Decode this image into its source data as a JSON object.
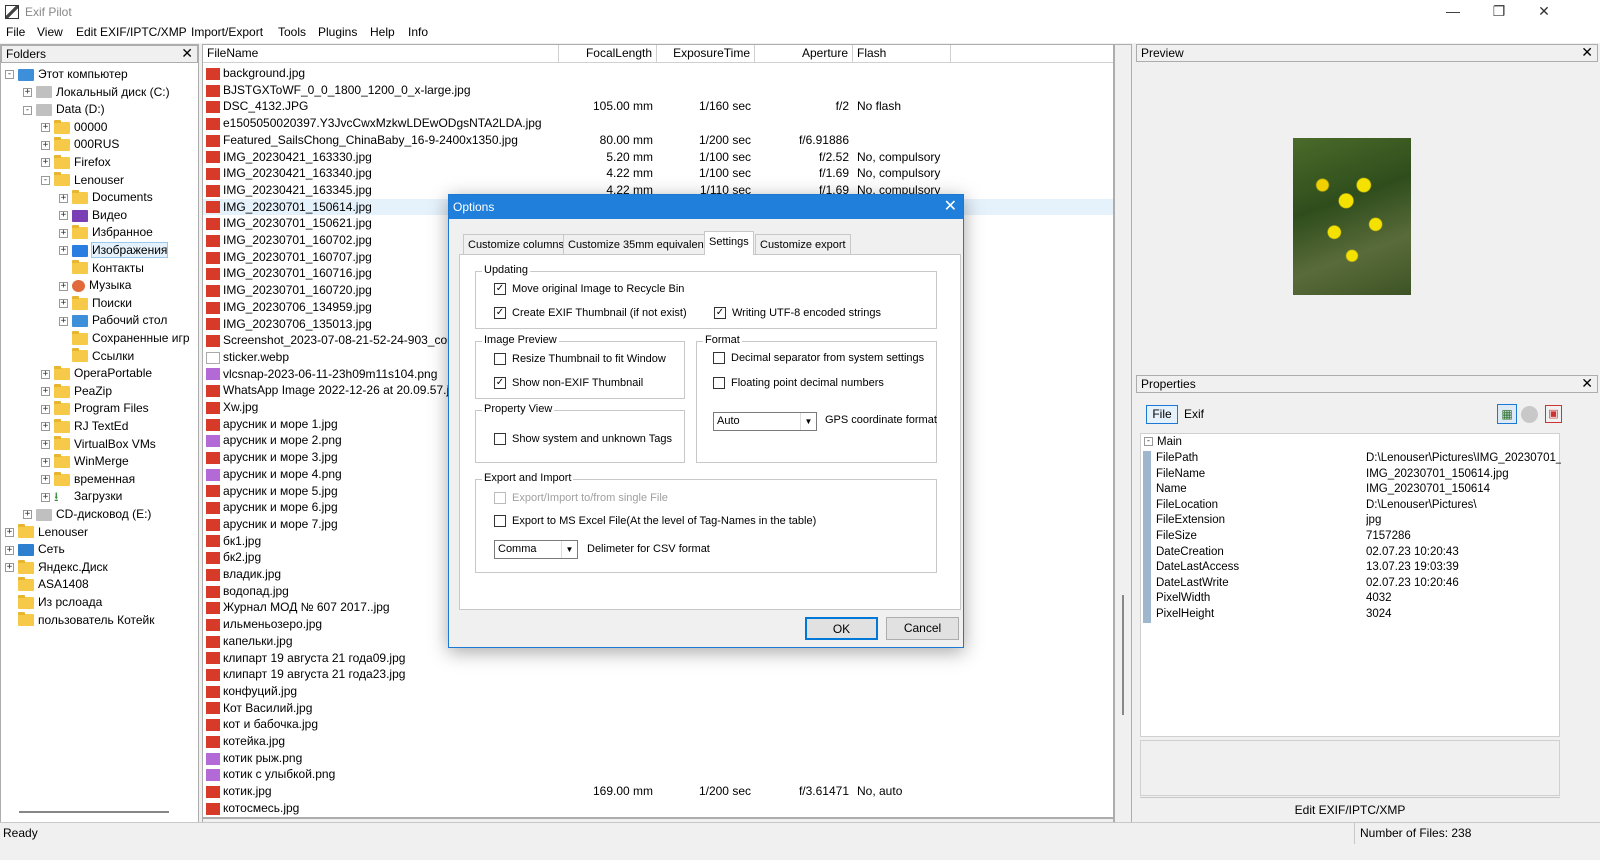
{
  "app": {
    "title": "Exif Pilot",
    "min": "—",
    "max": "❐",
    "close": "✕"
  },
  "menu": [
    "File",
    "View",
    "Edit EXIF/IPTC/XMP",
    "Import/Export",
    "Tools",
    "Plugins",
    "Help",
    "Info"
  ],
  "folders": {
    "title": "Folders",
    "close": "✕",
    "items": [
      {
        "label": "Этот компьютер",
        "indent": 0,
        "exp": "-",
        "icon": "pc"
      },
      {
        "label": "Локальный диск (C:)",
        "indent": 1,
        "exp": "+",
        "icon": "drv"
      },
      {
        "label": "Data (D:)",
        "indent": 1,
        "exp": "-",
        "icon": "drv"
      },
      {
        "label": "00000",
        "indent": 2,
        "exp": "+",
        "icon": "folder"
      },
      {
        "label": "000RUS",
        "indent": 2,
        "exp": "+",
        "icon": "folder"
      },
      {
        "label": "Firefox",
        "indent": 2,
        "exp": "+",
        "icon": "folder"
      },
      {
        "label": "Lenouser",
        "indent": 2,
        "exp": "-",
        "icon": "folder"
      },
      {
        "label": "Documents",
        "indent": 3,
        "exp": "+",
        "icon": "folder"
      },
      {
        "label": "Видео",
        "indent": 3,
        "exp": "+",
        "icon": "vid"
      },
      {
        "label": "Избранное",
        "indent": 3,
        "exp": "+",
        "icon": "folder"
      },
      {
        "label": "Изображения",
        "indent": 3,
        "exp": "+",
        "icon": "img",
        "selected": true
      },
      {
        "label": "Контакты",
        "indent": 3,
        "exp": "",
        "icon": "folder"
      },
      {
        "label": "Музыка",
        "indent": 3,
        "exp": "+",
        "icon": "mus"
      },
      {
        "label": "Поиски",
        "indent": 3,
        "exp": "+",
        "icon": "folder"
      },
      {
        "label": "Рабочий стол",
        "indent": 3,
        "exp": "+",
        "icon": "pc"
      },
      {
        "label": "Сохраненные игр",
        "indent": 3,
        "exp": "",
        "icon": "folder"
      },
      {
        "label": "Ссылки",
        "indent": 3,
        "exp": "",
        "icon": "folder"
      },
      {
        "label": "OperaPortable",
        "indent": 2,
        "exp": "+",
        "icon": "folder"
      },
      {
        "label": "PeaZip",
        "indent": 2,
        "exp": "+",
        "icon": "folder"
      },
      {
        "label": "Program Files",
        "indent": 2,
        "exp": "+",
        "icon": "folder"
      },
      {
        "label": "RJ TextEd",
        "indent": 2,
        "exp": "+",
        "icon": "folder"
      },
      {
        "label": "VirtualBox VMs",
        "indent": 2,
        "exp": "+",
        "icon": "folder"
      },
      {
        "label": "WinMerge",
        "indent": 2,
        "exp": "+",
        "icon": "folder"
      },
      {
        "label": "временная",
        "indent": 2,
        "exp": "+",
        "icon": "folder"
      },
      {
        "label": "Загрузки",
        "indent": 2,
        "exp": "+",
        "icon": "dl"
      },
      {
        "label": "CD-дисковод (E:)",
        "indent": 1,
        "exp": "+",
        "icon": "drv"
      },
      {
        "label": "Lenouser",
        "indent": 0,
        "exp": "+",
        "icon": "folder"
      },
      {
        "label": "Сеть",
        "indent": 0,
        "exp": "+",
        "icon": "net"
      },
      {
        "label": "Яндекс.Диск",
        "indent": 0,
        "exp": "+",
        "icon": "folder"
      },
      {
        "label": "ASA1408",
        "indent": 0,
        "exp": "",
        "icon": "folder"
      },
      {
        "label": "Из рслоада",
        "indent": 0,
        "exp": "",
        "icon": "folder"
      },
      {
        "label": "пользователь Котейк",
        "indent": 0,
        "exp": "",
        "icon": "folder"
      }
    ]
  },
  "filelist": {
    "columns": [
      "FileName",
      "FocalLength",
      "ExposureTime",
      "Aperture",
      "Flash"
    ],
    "rows": [
      {
        "name": "background.jpg",
        "type": "jpg",
        "focal": "",
        "exp": "",
        "ap": "",
        "flash": ""
      },
      {
        "name": "BJSTGXToWF_0_0_1800_1200_0_x-large.jpg",
        "type": "jpg",
        "focal": "",
        "exp": "",
        "ap": "",
        "flash": ""
      },
      {
        "name": "DSC_4132.JPG",
        "type": "jpg",
        "focal": "105.00 mm",
        "exp": "1/160 sec",
        "ap": "f/2",
        "flash": "No flash"
      },
      {
        "name": "e1505050020397.Y3JvcCwxMzkwLDEwODgsNTA2LDA.jpg",
        "type": "jpg",
        "focal": "",
        "exp": "",
        "ap": "",
        "flash": ""
      },
      {
        "name": "Featured_SailsChong_ChinaBaby_16-9-2400x1350.jpg",
        "type": "jpg",
        "focal": "80.00 mm",
        "exp": "1/200 sec",
        "ap": "f/6.91886",
        "flash": ""
      },
      {
        "name": "IMG_20230421_163330.jpg",
        "type": "jpg",
        "focal": "5.20 mm",
        "exp": "1/100 sec",
        "ap": "f/2.52",
        "flash": "No, compulsory"
      },
      {
        "name": "IMG_20230421_163340.jpg",
        "type": "jpg",
        "focal": "4.22 mm",
        "exp": "1/100 sec",
        "ap": "f/1.69",
        "flash": "No, compulsory"
      },
      {
        "name": "IMG_20230421_163345.jpg",
        "type": "jpg",
        "focal": "4.22 mm",
        "exp": "1/110 sec",
        "ap": "f/1.69",
        "flash": "No, compulsory"
      },
      {
        "name": "IMG_20230701_150614.jpg",
        "type": "jpg",
        "focal": "",
        "exp": "",
        "ap": "",
        "flash": "",
        "selected": true
      },
      {
        "name": "IMG_20230701_150621.jpg",
        "type": "jpg",
        "focal": "",
        "exp": "",
        "ap": "",
        "flash": ""
      },
      {
        "name": "IMG_20230701_160702.jpg",
        "type": "jpg",
        "focal": "",
        "exp": "",
        "ap": "",
        "flash": ""
      },
      {
        "name": "IMG_20230701_160707.jpg",
        "type": "jpg",
        "focal": "",
        "exp": "",
        "ap": "",
        "flash": ""
      },
      {
        "name": "IMG_20230701_160716.jpg",
        "type": "jpg",
        "focal": "",
        "exp": "",
        "ap": "",
        "flash": ""
      },
      {
        "name": "IMG_20230701_160720.jpg",
        "type": "jpg",
        "focal": "",
        "exp": "",
        "ap": "",
        "flash": ""
      },
      {
        "name": "IMG_20230706_134959.jpg",
        "type": "jpg",
        "focal": "",
        "exp": "",
        "ap": "",
        "flash": ""
      },
      {
        "name": "IMG_20230706_135013.jpg",
        "type": "jpg",
        "focal": "",
        "exp": "",
        "ap": "",
        "flash": ""
      },
      {
        "name": "Screenshot_2023-07-08-21-52-24-903_com.m",
        "type": "jpg",
        "focal": "",
        "exp": "",
        "ap": "",
        "flash": ""
      },
      {
        "name": "sticker.webp",
        "type": "webp",
        "focal": "",
        "exp": "",
        "ap": "",
        "flash": ""
      },
      {
        "name": "vlcsnap-2023-06-11-23h09m11s104.png",
        "type": "png",
        "focal": "",
        "exp": "",
        "ap": "",
        "flash": ""
      },
      {
        "name": "WhatsApp Image 2022-12-26 at 20.09.57.jpe",
        "type": "jpg",
        "focal": "",
        "exp": "",
        "ap": "",
        "flash": ""
      },
      {
        "name": "Xw.jpg",
        "type": "jpg",
        "focal": "",
        "exp": "",
        "ap": "",
        "flash": ""
      },
      {
        "name": "арусник и море 1.jpg",
        "type": "jpg",
        "focal": "",
        "exp": "",
        "ap": "",
        "flash": ""
      },
      {
        "name": "арусник и море 2.png",
        "type": "png",
        "focal": "",
        "exp": "",
        "ap": "",
        "flash": ""
      },
      {
        "name": "арусник и море 3.jpg",
        "type": "jpg",
        "focal": "",
        "exp": "",
        "ap": "",
        "flash": ""
      },
      {
        "name": "арусник и море 4.png",
        "type": "png",
        "focal": "",
        "exp": "",
        "ap": "",
        "flash": ""
      },
      {
        "name": "арусник и море 5.jpg",
        "type": "jpg",
        "focal": "",
        "exp": "",
        "ap": "",
        "flash": ""
      },
      {
        "name": "арусник и море 6.jpg",
        "type": "jpg",
        "focal": "",
        "exp": "",
        "ap": "",
        "flash": ""
      },
      {
        "name": "арусник и море 7.jpg",
        "type": "jpg",
        "focal": "",
        "exp": "",
        "ap": "",
        "flash": ""
      },
      {
        "name": "бк1.jpg",
        "type": "jpg",
        "focal": "",
        "exp": "",
        "ap": "",
        "flash": ""
      },
      {
        "name": "бк2.jpg",
        "type": "jpg",
        "focal": "",
        "exp": "",
        "ap": "",
        "flash": ""
      },
      {
        "name": "владик.jpg",
        "type": "jpg",
        "focal": "",
        "exp": "",
        "ap": "",
        "flash": ""
      },
      {
        "name": "водопад.jpg",
        "type": "jpg",
        "focal": "",
        "exp": "",
        "ap": "",
        "flash": ""
      },
      {
        "name": "Журнал МОД № 607 2017..jpg",
        "type": "jpg",
        "focal": "",
        "exp": "",
        "ap": "",
        "flash": ""
      },
      {
        "name": "ильменьозеро.jpg",
        "type": "jpg",
        "focal": "",
        "exp": "",
        "ap": "",
        "flash": ""
      },
      {
        "name": "капельки.jpg",
        "type": "jpg",
        "focal": "",
        "exp": "",
        "ap": "",
        "flash": ""
      },
      {
        "name": "клипарт 19 августа 21 года09.jpg",
        "type": "jpg",
        "focal": "",
        "exp": "",
        "ap": "",
        "flash": ""
      },
      {
        "name": "клипарт 19 августа 21 года23.jpg",
        "type": "jpg",
        "focal": "",
        "exp": "",
        "ap": "",
        "flash": ""
      },
      {
        "name": "конфуций.jpg",
        "type": "jpg",
        "focal": "",
        "exp": "",
        "ap": "",
        "flash": ""
      },
      {
        "name": "Кот Василий.jpg",
        "type": "jpg",
        "focal": "",
        "exp": "",
        "ap": "",
        "flash": ""
      },
      {
        "name": "кот и бабочка.jpg",
        "type": "jpg",
        "focal": "",
        "exp": "",
        "ap": "",
        "flash": ""
      },
      {
        "name": "котейка.jpg",
        "type": "jpg",
        "focal": "",
        "exp": "",
        "ap": "",
        "flash": ""
      },
      {
        "name": "котик рыж.png",
        "type": "png",
        "focal": "",
        "exp": "",
        "ap": "",
        "flash": ""
      },
      {
        "name": "котик с улыбкой.png",
        "type": "png",
        "focal": "",
        "exp": "",
        "ap": "",
        "flash": ""
      },
      {
        "name": "котик.jpg",
        "type": "jpg",
        "focal": "169.00 mm",
        "exp": "1/200 sec",
        "ap": "f/3.61471",
        "flash": "No, auto"
      },
      {
        "name": "котосмесь.jpg",
        "type": "jpg",
        "focal": "",
        "exp": "",
        "ap": "",
        "flash": ""
      }
    ]
  },
  "preview": {
    "title": "Preview",
    "close": "✕"
  },
  "properties": {
    "title": "Properties",
    "close": "✕",
    "tab_file": "File",
    "tab_exif": "Exif",
    "section": "Main",
    "rows": [
      {
        "name": "FilePath",
        "value": "D:\\Lenouser\\Pictures\\IMG_20230701_..."
      },
      {
        "name": "FileName",
        "value": "IMG_20230701_150614.jpg"
      },
      {
        "name": "Name",
        "value": "IMG_20230701_150614"
      },
      {
        "name": "FileLocation",
        "value": "D:\\Lenouser\\Pictures\\"
      },
      {
        "name": "FileExtension",
        "value": "jpg"
      },
      {
        "name": "FileSize",
        "value": "7157286"
      },
      {
        "name": "DateCreation",
        "value": "02.07.23 10:20:43"
      },
      {
        "name": "DateLastAccess",
        "value": "13.07.23 19:03:39"
      },
      {
        "name": "DateLastWrite",
        "value": "02.07.23 10:20:46"
      },
      {
        "name": "PixelWidth",
        "value": "4032"
      },
      {
        "name": "PixelHeight",
        "value": "3024"
      }
    ],
    "edit_button": "Edit EXIF/IPTC/XMP"
  },
  "status": {
    "left": "Ready",
    "right": "Number of Files: 238"
  },
  "dialog": {
    "title": "Options",
    "close": "✕",
    "tabs": [
      "Customize columns",
      "Customize 35mm equivalent",
      "Settings",
      "Customize export"
    ],
    "updating": {
      "label": "Updating",
      "move_bin": "Move original Image to Recycle Bin",
      "create_thumb": "Create EXIF Thumbnail (if not exist)",
      "utf8": "Writing UTF-8 encoded strings"
    },
    "image_preview": {
      "label": "Image Preview",
      "resize": "Resize Thumbnail to fit Window",
      "show_nonexif": "Show non-EXIF Thumbnail"
    },
    "format": {
      "label": "Format",
      "decimal_sep": "Decimal separator from system settings",
      "float_point": "Floating point decimal numbers",
      "gps_value": "Auto",
      "gps_label": "GPS coordinate format"
    },
    "property_view": {
      "label": "Property View",
      "show_system": "Show system and unknown Tags"
    },
    "export": {
      "label": "Export and Import",
      "single_file": "Export/Import  to/from single File",
      "excel": "Export to MS Excel File(At the level of Tag-Names in the table)",
      "csv_value": "Comma",
      "csv_label": "Delimeter for CSV format"
    },
    "ok": "OK",
    "cancel": "Cancel"
  }
}
